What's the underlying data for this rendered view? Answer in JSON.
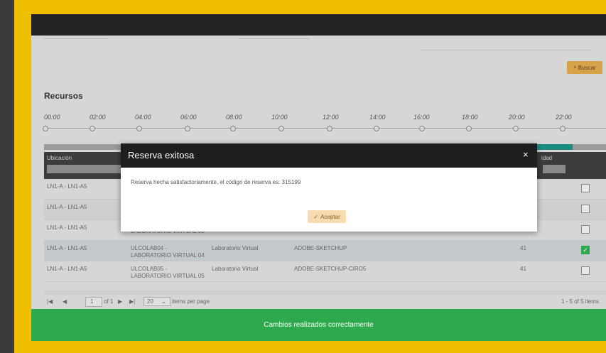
{
  "search": {
    "button_label": "Buscar"
  },
  "recursos": {
    "title": "Recursos",
    "timeline": [
      "00:00",
      "02:00",
      "04:00",
      "06:00",
      "08:00",
      "10:00",
      "12:00",
      "14:00",
      "16:00",
      "18:00",
      "20:00",
      "22:00"
    ]
  },
  "table": {
    "headers": {
      "ubicacion": "Ubicación",
      "capacidad": "idad"
    },
    "rows": [
      {
        "ubicacion": "LN1-A - LN1-A5",
        "codigo": "",
        "tipo": "",
        "software": "",
        "cap": "",
        "checked": false
      },
      {
        "ubicacion": "LN1-A - LN1-A5",
        "codigo": "",
        "tipo": "",
        "software": "",
        "cap": "",
        "checked": false
      },
      {
        "ubicacion": "LN1-A - LN1-A5",
        "codigo": "LABORATORIO VIRTUAL 03",
        "tipo": "",
        "software": "",
        "cap": "",
        "checked": false
      },
      {
        "ubicacion": "LN1-A - LN1-A5",
        "codigo": "ULCOLAB04 - LABORATORIO VIRTUAL 04",
        "tipo": "Laboratorio Virtual",
        "software": "ADOBE-SKETCHUP",
        "cap": "41",
        "checked": true
      },
      {
        "ubicacion": "LN1-A - LN1-A5",
        "codigo": "ULCOLAB05 - LABORATORIO VIRTUAL 05",
        "tipo": "Laboratorio Virtual",
        "software": "ADOBE-SKETCHUP-CIRO5",
        "cap": "41",
        "checked": false
      }
    ]
  },
  "pager": {
    "page": "1",
    "page_of": "of 1",
    "per_page": "20",
    "per_page_label": "items per page",
    "summary": "1 - 5 of 5 items"
  },
  "modal": {
    "title": "Reserva exitosa",
    "close": "×",
    "message": "Reserva hecha satisfactoriamente, el código de reserva es: 315199",
    "accept_label": "Aceptar",
    "accept_icon": "✓"
  },
  "toast": {
    "message": "Cambios realizados correctamente"
  },
  "colors": {
    "frame": "#f0c000",
    "toast": "#2ea84d",
    "buscar": "#d6a24a",
    "accept": "#f6dcb0"
  }
}
